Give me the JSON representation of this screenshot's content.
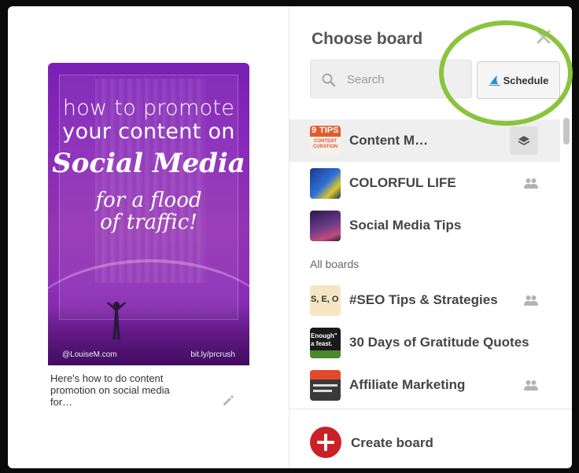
{
  "dialog": {
    "title": "Choose board",
    "close_icon": "close-icon"
  },
  "pin": {
    "image_text": {
      "line1": "how to promote",
      "line2": "your content on",
      "line3": "Social Media",
      "line4": "for a flood",
      "line5": "of traffic!",
      "credit_left": "@LouiseM.com",
      "credit_right": "bit.ly/prcrush"
    },
    "description": "Here's how to do content promotion on social media for…",
    "edit_icon": "pencil-icon"
  },
  "search": {
    "placeholder": "Search",
    "value": "",
    "icon": "search-icon"
  },
  "schedule_button": {
    "label": "Schedule",
    "icon": "sail-icon"
  },
  "boards": {
    "recent": [
      {
        "name": "Content M…",
        "selected": true,
        "icon": "layers-icon"
      },
      {
        "name": "COLORFUL LIFE",
        "icon": "group-icon"
      },
      {
        "name": "Social Media Tips"
      }
    ],
    "all_label": "All boards",
    "all": [
      {
        "name": "#SEO Tips & Strategies",
        "icon": "group-icon"
      },
      {
        "name": "30 Days of Gratitude Quotes"
      },
      {
        "name": "Affiliate Marketing",
        "icon": "group-icon"
      }
    ]
  },
  "thumb_text": {
    "tips_number": "9",
    "tips_word": "TIPS",
    "curation": "CONTENT CURATION",
    "seo": "S, E, O",
    "gratitude": "Enough\" a feast."
  },
  "footer": {
    "create_label": "Create board",
    "icon": "plus-circle-icon"
  },
  "colors": {
    "accent_red": "#cb2027",
    "highlight_green": "#8ac43c",
    "pin_purple": "#8a2ab8"
  }
}
